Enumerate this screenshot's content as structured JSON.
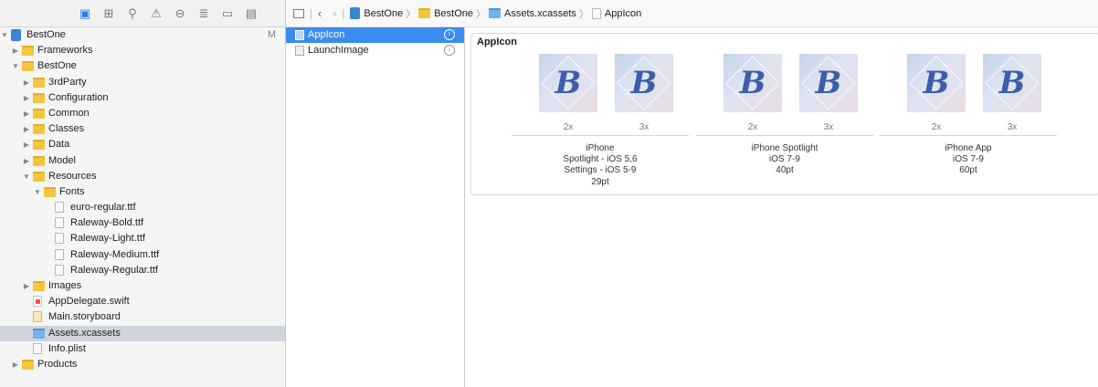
{
  "navigator": {
    "toolbar_icons": [
      "folder-icon",
      "hierarchy-icon",
      "search-icon",
      "warning-icon",
      "test-icon",
      "debug-icon",
      "breakpoint-icon",
      "report-icon"
    ],
    "items": [
      {
        "label": "BestOne",
        "kind": "project",
        "depth": 0,
        "disclosure": "open",
        "flag": "M"
      },
      {
        "label": "Frameworks",
        "kind": "folder",
        "depth": 1,
        "disclosure": "closed"
      },
      {
        "label": "BestOne",
        "kind": "folder",
        "depth": 1,
        "disclosure": "open"
      },
      {
        "label": "3rdParty",
        "kind": "folder",
        "depth": 2,
        "disclosure": "closed"
      },
      {
        "label": "Configuration",
        "kind": "folder",
        "depth": 2,
        "disclosure": "closed"
      },
      {
        "label": "Common",
        "kind": "folder",
        "depth": 2,
        "disclosure": "closed"
      },
      {
        "label": "Classes",
        "kind": "folder",
        "depth": 2,
        "disclosure": "closed"
      },
      {
        "label": "Data",
        "kind": "folder",
        "depth": 2,
        "disclosure": "closed"
      },
      {
        "label": "Model",
        "kind": "folder",
        "depth": 2,
        "disclosure": "closed"
      },
      {
        "label": "Resources",
        "kind": "folder",
        "depth": 2,
        "disclosure": "open"
      },
      {
        "label": "Fonts",
        "kind": "folder",
        "depth": 3,
        "disclosure": "open"
      },
      {
        "label": "euro-regular.ttf",
        "kind": "file",
        "depth": 4
      },
      {
        "label": "Raleway-Bold.ttf",
        "kind": "file",
        "depth": 4
      },
      {
        "label": "Raleway-Light.ttf",
        "kind": "file",
        "depth": 4
      },
      {
        "label": "Raleway-Medium.ttf",
        "kind": "file",
        "depth": 4
      },
      {
        "label": "Raleway-Regular.ttf",
        "kind": "file",
        "depth": 4
      },
      {
        "label": "Images",
        "kind": "folder",
        "depth": 2,
        "disclosure": "closed"
      },
      {
        "label": "AppDelegate.swift",
        "kind": "swift",
        "depth": 2
      },
      {
        "label": "Main.storyboard",
        "kind": "storyboard",
        "depth": 2
      },
      {
        "label": "Assets.xcassets",
        "kind": "assets",
        "depth": 2,
        "selected": true
      },
      {
        "label": "Info.plist",
        "kind": "file",
        "depth": 2
      },
      {
        "label": "Products",
        "kind": "folder",
        "depth": 1,
        "disclosure": "closed"
      }
    ]
  },
  "jumpbar": {
    "crumbs": [
      {
        "label": "BestOne",
        "icon": "project-icon"
      },
      {
        "label": "BestOne",
        "icon": "folder-icon"
      },
      {
        "label": "Assets.xcassets",
        "icon": "asset-catalog-icon"
      },
      {
        "label": "AppIcon",
        "icon": "appicon-icon"
      }
    ]
  },
  "asset_list": [
    {
      "label": "AppIcon",
      "selected": true
    },
    {
      "label": "LaunchImage",
      "selected": false
    }
  ],
  "editor": {
    "set_title": "AppIcon",
    "glyph": "B",
    "groups": [
      {
        "scales": [
          "2x",
          "3x"
        ],
        "lines": [
          "iPhone",
          "Spotlight - iOS 5,6",
          "Settings - iOS 5-9",
          "29pt"
        ]
      },
      {
        "scales": [
          "2x",
          "3x"
        ],
        "lines": [
          "iPhone Spotlight",
          "iOS 7-9",
          "40pt"
        ]
      },
      {
        "scales": [
          "2x",
          "3x"
        ],
        "lines": [
          "iPhone App",
          "iOS 7-9",
          "60pt"
        ]
      }
    ]
  },
  "colors": {
    "selection_blue": "#3a8cf1",
    "folder_yellow": "#f4c53e",
    "sidebar_bg": "#f5f5f5"
  }
}
